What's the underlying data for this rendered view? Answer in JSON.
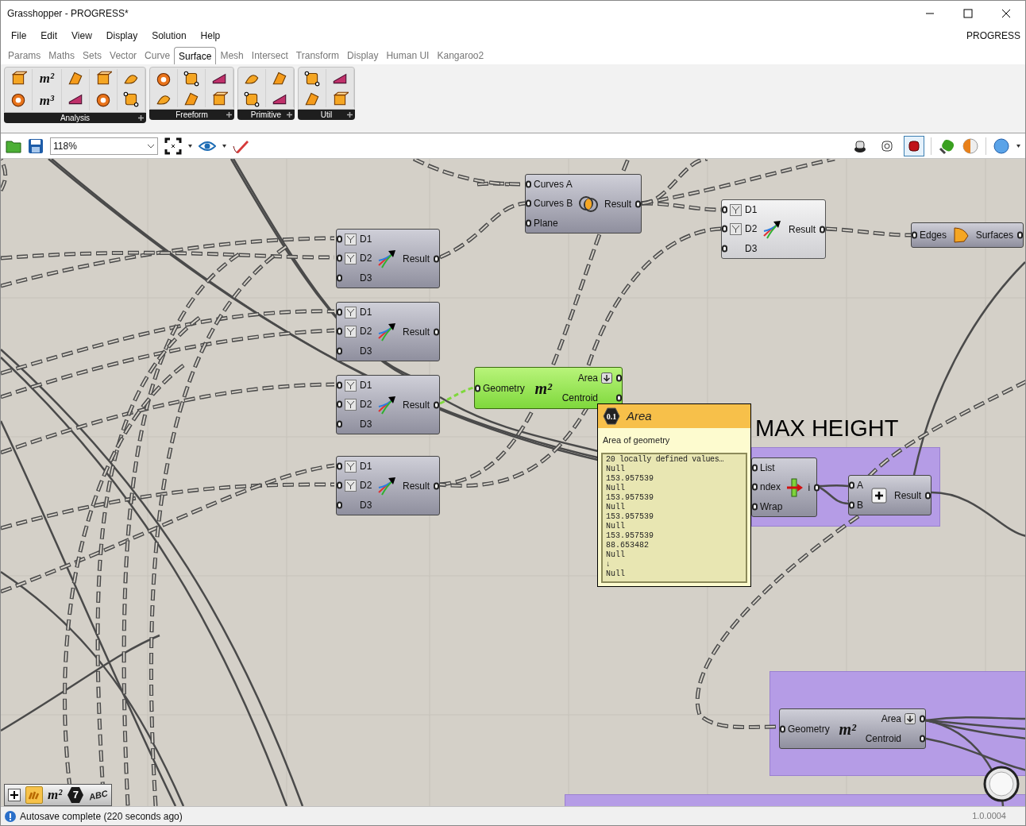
{
  "window": {
    "title": "Grasshopper - PROGRESS*"
  },
  "menu": {
    "items": [
      "File",
      "Edit",
      "View",
      "Display",
      "Solution",
      "Help"
    ],
    "document": "PROGRESS"
  },
  "tabs": [
    {
      "label": "Params",
      "selected": false
    },
    {
      "label": "Maths",
      "selected": false
    },
    {
      "label": "Sets",
      "selected": false
    },
    {
      "label": "Vector",
      "selected": false
    },
    {
      "label": "Curve",
      "selected": false
    },
    {
      "label": "Surface",
      "selected": true
    },
    {
      "label": "Mesh",
      "selected": false
    },
    {
      "label": "Intersect",
      "selected": false
    },
    {
      "label": "Transform",
      "selected": false
    },
    {
      "label": "Display",
      "selected": false
    },
    {
      "label": "Human UI",
      "selected": false
    },
    {
      "label": "Kangaroo2",
      "selected": false
    }
  ],
  "ribbon": [
    {
      "label": "Analysis",
      "glyphs": [
        "m²",
        "m³"
      ]
    },
    {
      "label": "Freeform"
    },
    {
      "label": "Primitive"
    },
    {
      "label": "Util"
    }
  ],
  "toolbar": {
    "zoom": "118%",
    "preview_modes": [
      {
        "selected": false
      },
      {
        "selected": false
      },
      {
        "selected": true
      }
    ]
  },
  "canvas": {
    "groups": [
      {
        "title": "MAX HEIGHT"
      }
    ],
    "nodes": [
      {
        "kind": "intersect",
        "selected": false,
        "highlighted": false,
        "inputs": [
          {
            "label": "Curves A"
          },
          {
            "label": "Curves B"
          },
          {
            "label": "Plane"
          }
        ],
        "outputs": [
          {
            "label": "Result"
          }
        ]
      },
      {
        "kind": "vector",
        "selected": false,
        "highlighted": true,
        "inputs": [
          {
            "label": "D1",
            "modifier": true
          },
          {
            "label": "D2",
            "modifier": true
          },
          {
            "label": "D3",
            "modifier": false
          }
        ],
        "outputs": [
          {
            "label": "Result"
          }
        ]
      },
      {
        "kind": "boundary",
        "selected": false,
        "highlighted": false,
        "inputs": [
          {
            "label": "Edges"
          }
        ],
        "outputs": [
          {
            "label": "Surfaces"
          }
        ]
      },
      {
        "kind": "vector",
        "selected": false,
        "highlighted": false,
        "inputs": [
          {
            "label": "D1",
            "modifier": true
          },
          {
            "label": "D2",
            "modifier": true
          },
          {
            "label": "D3",
            "modifier": false
          }
        ],
        "outputs": [
          {
            "label": "Result"
          }
        ]
      },
      {
        "kind": "vector",
        "selected": false,
        "highlighted": false,
        "inputs": [
          {
            "label": "D1",
            "modifier": true
          },
          {
            "label": "D2",
            "modifier": true
          },
          {
            "label": "D3",
            "modifier": false
          }
        ],
        "outputs": [
          {
            "label": "Result"
          }
        ]
      },
      {
        "kind": "vector",
        "selected": false,
        "highlighted": false,
        "inputs": [
          {
            "label": "D1",
            "modifier": true
          },
          {
            "label": "D2",
            "modifier": true
          },
          {
            "label": "D3",
            "modifier": false
          }
        ],
        "outputs": [
          {
            "label": "Result"
          }
        ]
      },
      {
        "kind": "vector",
        "selected": false,
        "highlighted": false,
        "inputs": [
          {
            "label": "D1",
            "modifier": true
          },
          {
            "label": "D2",
            "modifier": true
          },
          {
            "label": "D3",
            "modifier": false
          }
        ],
        "outputs": [
          {
            "label": "Result"
          }
        ]
      },
      {
        "kind": "area",
        "selected": true,
        "highlighted": false,
        "glyph": "m²",
        "inputs": [
          {
            "label": "Geometry"
          }
        ],
        "outputs": [
          {
            "label": "Area"
          },
          {
            "label": "Centroid"
          }
        ]
      },
      {
        "kind": "list-item",
        "selected": false,
        "highlighted": false,
        "inputs": [
          {
            "label": "List"
          },
          {
            "label": "ndex"
          },
          {
            "label": "Wrap"
          }
        ],
        "outputs": [
          {
            "label": "i"
          }
        ]
      },
      {
        "kind": "addition",
        "selected": false,
        "highlighted": false,
        "inputs": [
          {
            "label": "A"
          },
          {
            "label": "B"
          }
        ],
        "outputs": [
          {
            "label": "Result"
          }
        ]
      },
      {
        "kind": "area",
        "selected": false,
        "highlighted": false,
        "glyph": "m²",
        "inputs": [
          {
            "label": "Geometry"
          }
        ],
        "outputs": [
          {
            "label": "Area"
          },
          {
            "label": "Centroid"
          }
        ]
      }
    ],
    "tooltip": {
      "badge": "0.1",
      "title": "Area",
      "description": "Area of geometry",
      "header": "20 locally defined values…",
      "values": [
        "Null",
        "153.957539",
        "Null",
        "153.957539",
        "Null",
        "153.957539",
        "Null",
        "153.957539",
        "88.653482",
        "Null",
        "↓",
        "Null"
      ]
    },
    "canvas_bar": {
      "wire_display_on": true,
      "glyphs": [
        "m²",
        "7",
        "ABC"
      ]
    }
  },
  "status_bar": {
    "message": "Autosave complete (220 seconds ago)",
    "version": "1.0.0004"
  }
}
